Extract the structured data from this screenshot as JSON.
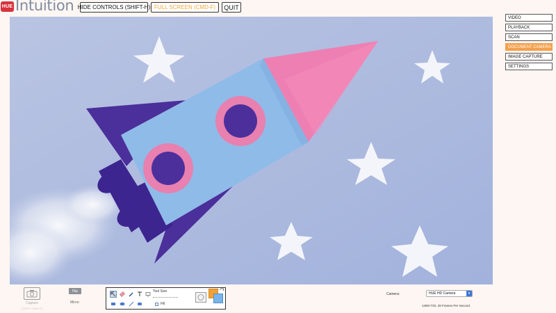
{
  "header": {
    "logo_text": "HUE",
    "app_title": "Intuition",
    "hide_controls_label": "HIDE CONTROLS (SHIFT-H)",
    "full_screen_label": "FULL SCREEN (CMD-F)",
    "quit_label": "QUIT"
  },
  "right_menu": {
    "items": [
      {
        "label": "VIDEO",
        "active": false
      },
      {
        "label": "PLAYBACK",
        "active": false
      },
      {
        "label": "SCAN",
        "active": false
      },
      {
        "label": "DOCUMENT CAMERA",
        "active": true
      },
      {
        "label": "IMAGE CAPTURE",
        "active": false
      },
      {
        "label": "SETTINGS",
        "active": false
      }
    ],
    "active_color": "#f5a04a"
  },
  "bottom": {
    "capture_label": "Capture",
    "capture_sub": "(SHIFT+CMD+S)",
    "flip_label": "Flip",
    "mirror_label": "Mirror",
    "tool_size_label": "Tool Size",
    "fill_label": "Fill",
    "camera_label": "Camera:",
    "camera_value": "HUE HD Camera",
    "camera_info": "1280×720, 29 Frames Per Second",
    "primary_color": "#f5a030",
    "secondary_color": "#78b4ea"
  },
  "icons": {
    "camera": "camera-icon",
    "select": "select-tool-icon",
    "eraser": "eraser-tool-icon",
    "pen": "pen-tool-icon",
    "text": "text-tool-icon",
    "screen": "screen-tool-icon",
    "rect": "rectangle-tool-icon",
    "ellipse": "ellipse-tool-icon",
    "line": "line-tool-icon",
    "rounded_rect": "rounded-rectangle-tool-icon",
    "swap": "swap-colors-icon",
    "dropdown": "chevron-down-icon"
  }
}
